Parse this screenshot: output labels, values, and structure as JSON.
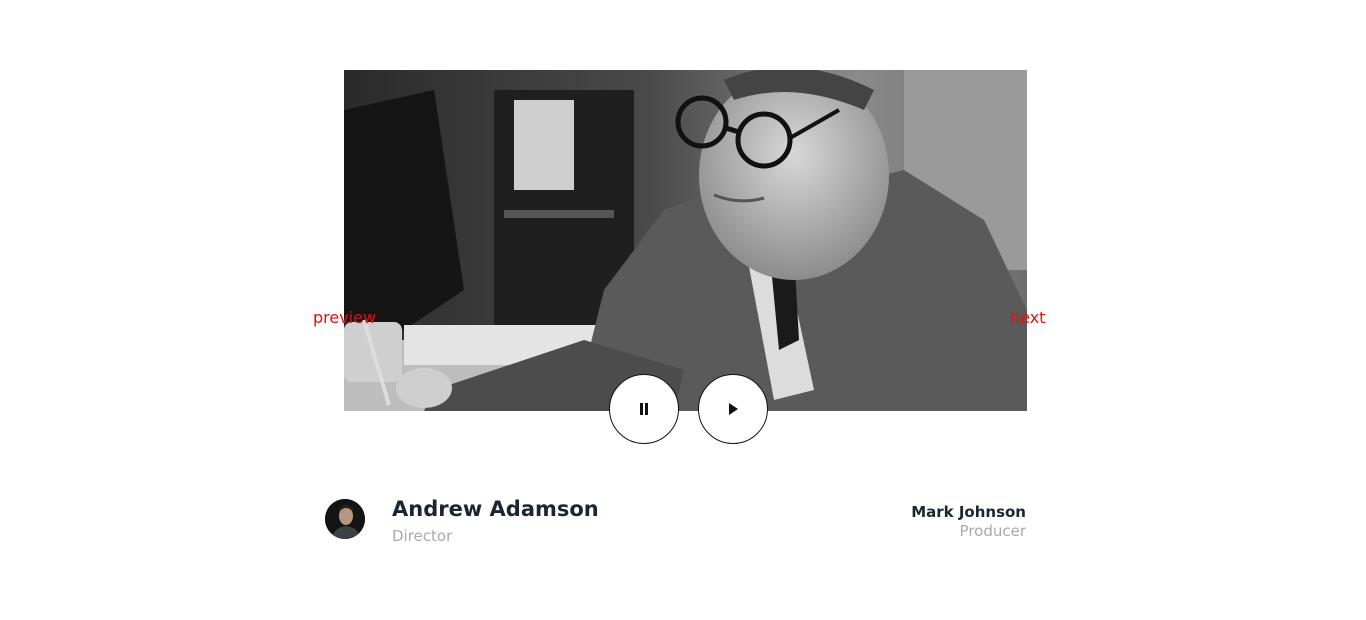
{
  "slider": {
    "image_alt": "black and white photograph of a man with round glasses writing at a desk",
    "prev_label": "preview",
    "next_label": "next"
  },
  "controls": {
    "pause_icon": "pause-icon",
    "play_icon": "play-icon"
  },
  "credits": {
    "director": {
      "name": "Andrew Adamson",
      "role": "Director"
    },
    "producer": {
      "name": "Mark Johnson",
      "role": "Producer"
    }
  },
  "colors": {
    "nav_link": "#e01010",
    "name_text": "#1c2630",
    "role_text": "#a9a9a9"
  }
}
